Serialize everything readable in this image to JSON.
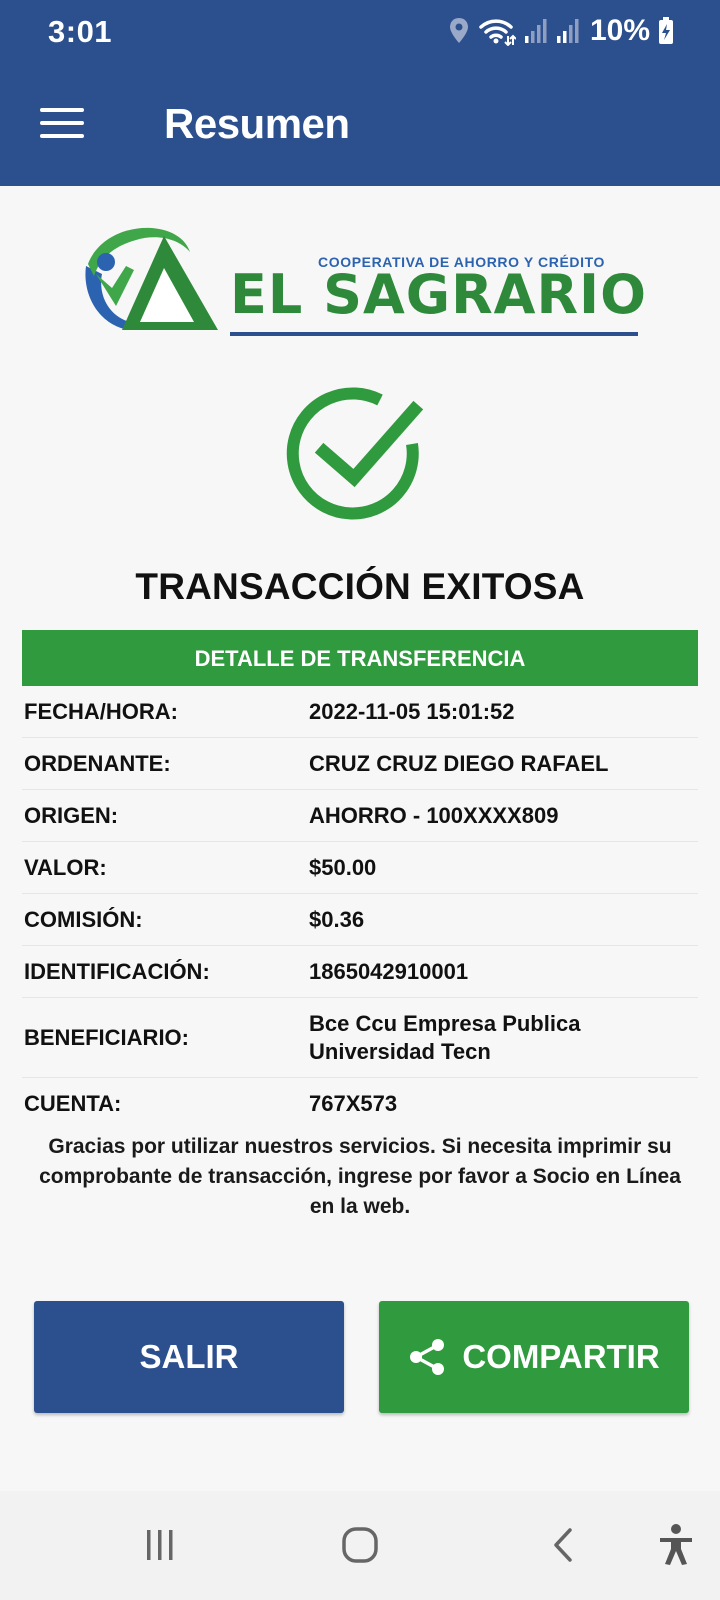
{
  "status": {
    "time": "3:01",
    "battery_text": "10%",
    "icons": [
      "location-icon",
      "wifi-icon",
      "signal-icon",
      "signal-icon",
      "battery-charging-icon"
    ]
  },
  "app_bar": {
    "title": "Resumen",
    "menu_icon": "hamburger-menu-icon",
    "background_color": "#2c4f8d"
  },
  "logo": {
    "subtitle": "COOPERATIVA DE AHORRO Y CRÉDITO",
    "name": "EL SAGRARIO"
  },
  "result": {
    "icon": "check-circle-icon",
    "title": "TRANSACCIÓN EXITOSA",
    "color": "#309a3e"
  },
  "detail": {
    "header": "DETALLE DE TRANSFERENCIA",
    "rows": [
      {
        "label": "FECHA/HORA:",
        "value": "2022-11-05 15:01:52"
      },
      {
        "label": "ORDENANTE:",
        "value": "CRUZ CRUZ DIEGO RAFAEL"
      },
      {
        "label": "ORIGEN:",
        "value": "AHORRO - 100XXXX809"
      },
      {
        "label": "VALOR:",
        "value": "$50.00"
      },
      {
        "label": "COMISIÓN:",
        "value": "$0.36"
      },
      {
        "label": "IDENTIFICACIÓN:",
        "value": "1865042910001"
      },
      {
        "label": "BENEFICIARIO:",
        "value": "Bce Ccu Empresa Publica Universidad Tecn"
      },
      {
        "label": "CUENTA:",
        "value": "767X573"
      }
    ]
  },
  "message": "Gracias por utilizar nuestros servicios. Si necesita imprimir su comprobante de transacción, ingrese por favor a Socio en Línea en la web.",
  "buttons": {
    "exit_label": "SALIR",
    "share_label": "COMPARTIR",
    "share_icon": "share-icon"
  },
  "nav": {
    "items": [
      "recent-apps-icon",
      "home-icon",
      "back-icon",
      "accessibility-icon"
    ]
  }
}
